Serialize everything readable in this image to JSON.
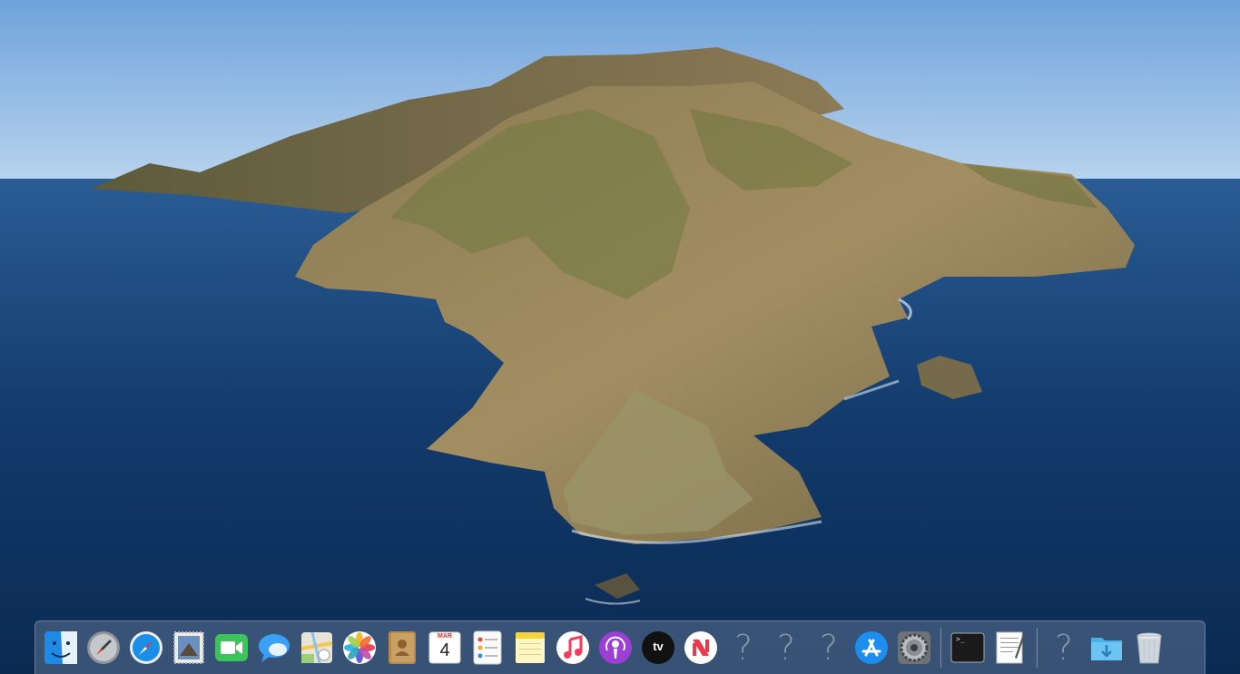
{
  "wallpaper": {
    "name": "macOS Catalina",
    "sky": "#8ab8e6",
    "sea": "#123a6b"
  },
  "dock": {
    "items": [
      {
        "name": "Finder",
        "icon": "finder-icon"
      },
      {
        "name": "Launchpad",
        "icon": "rocket-icon"
      },
      {
        "name": "Safari",
        "icon": "compass-icon"
      },
      {
        "name": "Mail",
        "icon": "stamp-icon"
      },
      {
        "name": "FaceTime",
        "icon": "video-camera-icon"
      },
      {
        "name": "Messages",
        "icon": "speech-bubble-icon"
      },
      {
        "name": "Maps",
        "icon": "map-icon"
      },
      {
        "name": "Photos",
        "icon": "flower-icon"
      },
      {
        "name": "Contacts",
        "icon": "address-book-icon"
      },
      {
        "name": "Calendar",
        "icon": "calendar-icon",
        "month": "MAR",
        "day": "4"
      },
      {
        "name": "Reminders",
        "icon": "checklist-icon"
      },
      {
        "name": "Notes",
        "icon": "notepad-icon"
      },
      {
        "name": "Music",
        "icon": "music-note-icon"
      },
      {
        "name": "Podcasts",
        "icon": "podcast-icon"
      },
      {
        "name": "TV",
        "icon": "tv-icon",
        "label": "tv"
      },
      {
        "name": "News",
        "icon": "news-icon"
      },
      {
        "name": "Unknown app",
        "icon": "question-mark-icon",
        "label": "?"
      },
      {
        "name": "Unknown app",
        "icon": "question-mark-icon",
        "label": "?"
      },
      {
        "name": "Unknown app",
        "icon": "question-mark-icon",
        "label": "?"
      },
      {
        "name": "App Store",
        "icon": "app-store-icon"
      },
      {
        "name": "System Preferences",
        "icon": "gear-icon"
      },
      {
        "name": "Terminal",
        "icon": "terminal-icon",
        "label": ">_"
      },
      {
        "name": "TextEdit",
        "icon": "text-document-icon"
      },
      {
        "name": "Unknown item",
        "icon": "question-mark-icon",
        "label": "?"
      },
      {
        "name": "Downloads",
        "icon": "download-folder-icon"
      },
      {
        "name": "Trash",
        "icon": "trash-icon"
      }
    ]
  }
}
